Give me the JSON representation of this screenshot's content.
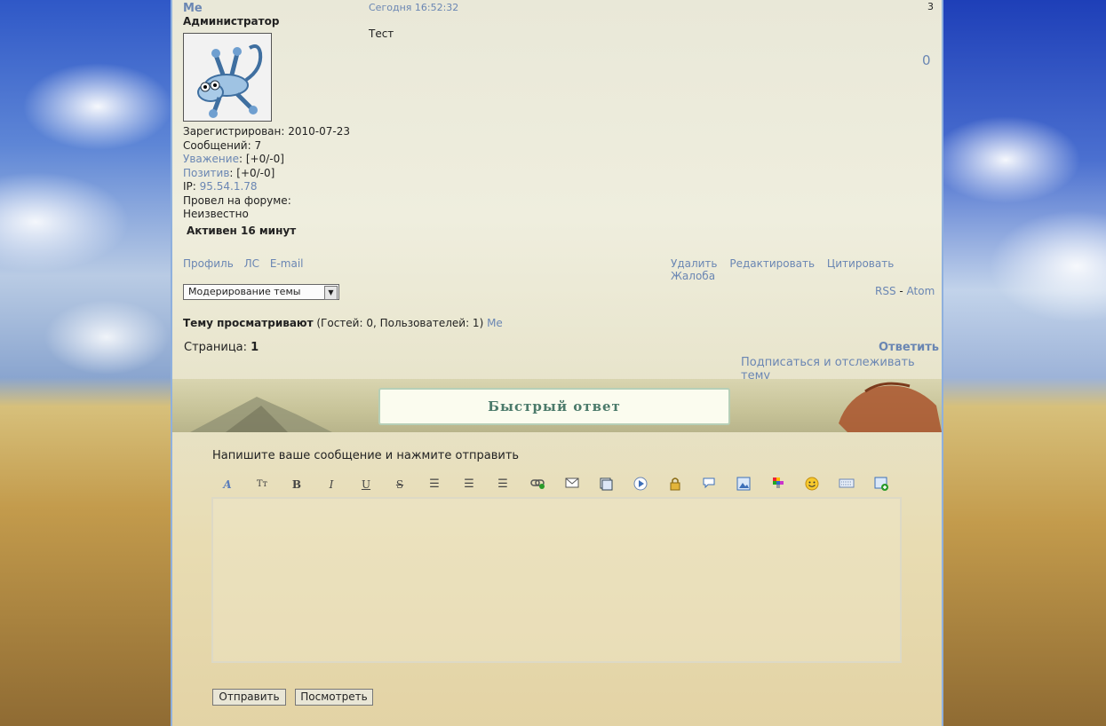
{
  "post": {
    "username": "Me",
    "rank": "Администратор",
    "registered_label": "Зарегистрирован:",
    "registered": "2010-07-23",
    "messages_label": "Сообщений:",
    "messages": "7",
    "respect_label": "Уважение",
    "respect_value": ": [+0/-0]",
    "positive_label": "Позитив",
    "positive_value": ": [+0/-0]",
    "ip_label": "IP:",
    "ip": "95.54.1.78",
    "time_label": "Провел на форуме:",
    "time_value": "Неизвестно",
    "active": "Активен 16 минут",
    "date": "Сегодня 16:52:32",
    "number": "3",
    "text": "Тест",
    "rating": "0"
  },
  "user_actions": [
    "Профиль",
    "ЛС",
    "E-mail"
  ],
  "post_actions": [
    "Удалить",
    "Редактировать",
    "Цитировать",
    "Жалоба"
  ],
  "moderation_select": "Модерирование темы",
  "feeds": {
    "rss": "RSS",
    "sep": " - ",
    "atom": "Atom"
  },
  "viewers": {
    "label": "Тему просматривают",
    "counts": " (Гостей: 0, Пользователей: 1) ",
    "user": "Me"
  },
  "pagination": {
    "label": "Страница: ",
    "current": "1"
  },
  "reply_link": "Ответить",
  "subscribe_link": "Подписаться и отслеживать тему",
  "quick_reply": {
    "title": "Быстрый ответ",
    "hint": "Напишите ваше сообщение и нажмите отправить",
    "textarea_value": "",
    "send_button": "Отправить",
    "preview_button": "Посмотреть"
  },
  "toolbar_icons": [
    "font-color-icon",
    "font-size-icon",
    "bold-icon",
    "italic-icon",
    "underline-icon",
    "strikethrough-icon",
    "align-left-icon",
    "align-center-icon",
    "align-right-icon",
    "link-icon",
    "email-icon",
    "code-icon",
    "video-icon",
    "hide-icon",
    "quote-icon",
    "image-icon",
    "color-icon",
    "smiley-icon",
    "keyboard-icon",
    "add-image-icon"
  ],
  "toolbar_glyphs": {
    "font_color": "A",
    "font_size": "Tт",
    "bold": "B",
    "italic": "I",
    "underline": "U",
    "strike": "S"
  }
}
